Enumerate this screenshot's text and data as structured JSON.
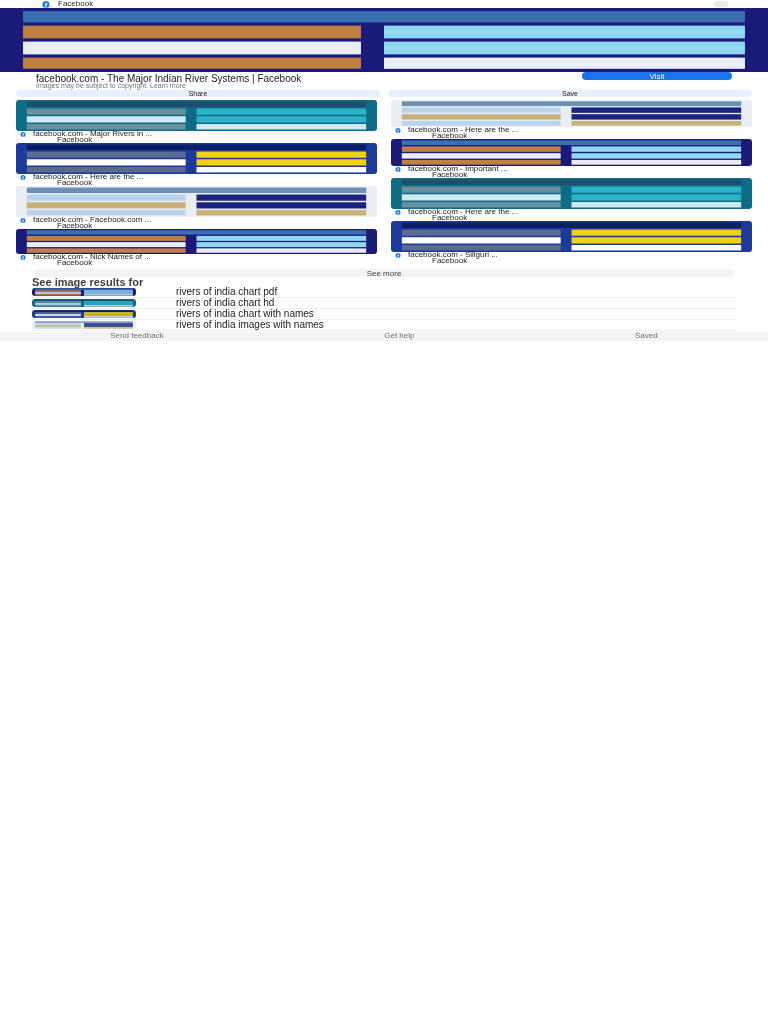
{
  "top_bar": {
    "source": "Facebook"
  },
  "preview": {
    "title": "facebook.com - The Major Indian River Systems | Facebook",
    "notice": "Images may be subject to copyright.",
    "notice_link": "Learn more",
    "visit": "Visit",
    "share": "Share",
    "save": "Save"
  },
  "columns": [
    [
      {
        "caption": "facebook.com - Major Rivers in ...",
        "source": "Facebook"
      },
      {
        "caption": "facebook.com - Here are the ...",
        "source": "Facebook"
      },
      {
        "caption": "facebook.com - Facebook.com ...",
        "source": "Facebook"
      },
      {
        "caption": "facebook.com - Nick Names of ...",
        "source": "Facebook"
      }
    ],
    [
      {
        "caption": "facebook.com - Here are the ...",
        "source": "Facebook"
      },
      {
        "caption": "facebook.com - Important ...",
        "source": "Facebook"
      },
      {
        "caption": "facebook.com - Here are the ...",
        "source": "Facebook"
      },
      {
        "caption": "facebook.com - Siliguri ...",
        "source": "Facebook"
      }
    ]
  ],
  "see_more": "See more",
  "related": {
    "heading": "See image results for",
    "items": [
      "rivers of india chart pdf",
      "rivers of india chart hd",
      "rivers of india chart with names",
      "rivers of india images with names"
    ]
  },
  "footer": [
    "Send feedback",
    "Get help",
    "Saved"
  ]
}
